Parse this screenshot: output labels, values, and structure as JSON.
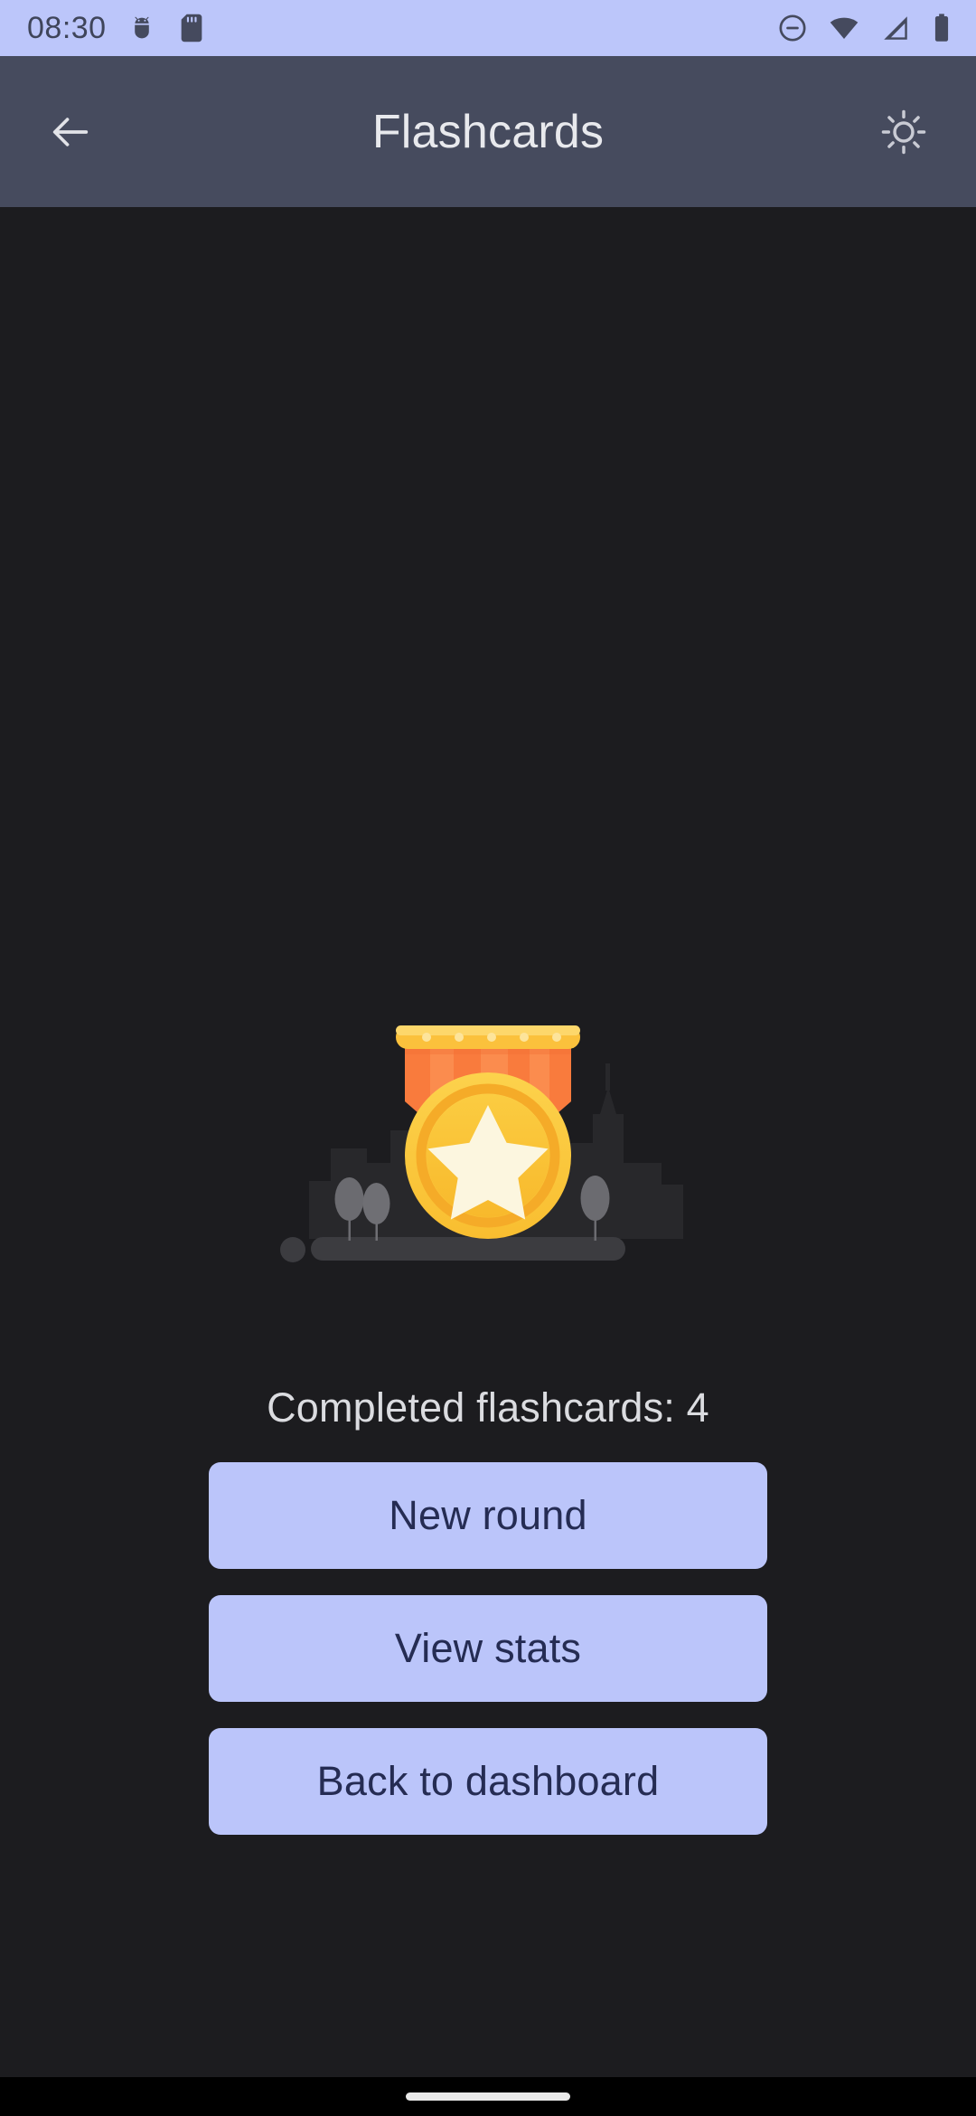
{
  "status_bar": {
    "time": "08:30",
    "background_color": "#BCC6FA",
    "icon_color": "#454A5E",
    "left_icons": [
      "android-debug-icon",
      "sd-card-icon"
    ],
    "right_icons": [
      "do-not-disturb-icon",
      "wifi-icon",
      "cellular-signal-icon",
      "battery-icon"
    ]
  },
  "app_bar": {
    "title": "Flashcards",
    "background_color": "#464B5E",
    "back_icon": "arrow-left-icon",
    "action_icon": "brightness-sun-icon"
  },
  "main": {
    "background_color": "#1C1C1F",
    "illustration": {
      "name": "gold-medal-award-illustration",
      "ribbon_color": "#F97B3D",
      "ribbon_highlight_color": "#FB8C4E",
      "bar_color": "#FBC13C",
      "bar_highlight_color": "#FDD76B",
      "coin_outer_color": "#FBC93E",
      "coin_ring_color": "#F5AB28",
      "coin_face_color": "#FBC93E",
      "star_color": "#FCF6DF",
      "skyline_color": "#28282B",
      "tree_color": "#6B6B70",
      "ground_color": "#3C3C40"
    },
    "completed_text": "Completed flashcards: 4",
    "completed_count": 4,
    "buttons": [
      {
        "label": "New round",
        "name": "new-round-button"
      },
      {
        "label": "View stats",
        "name": "view-stats-button"
      },
      {
        "label": "Back to dashboard",
        "name": "back-to-dashboard-button"
      }
    ],
    "button_background_color": "#BBC5FA",
    "button_text_color": "#252C53"
  },
  "navigation_bar": {
    "background_color": "#000000",
    "home_indicator_color": "#E9E9E9"
  }
}
